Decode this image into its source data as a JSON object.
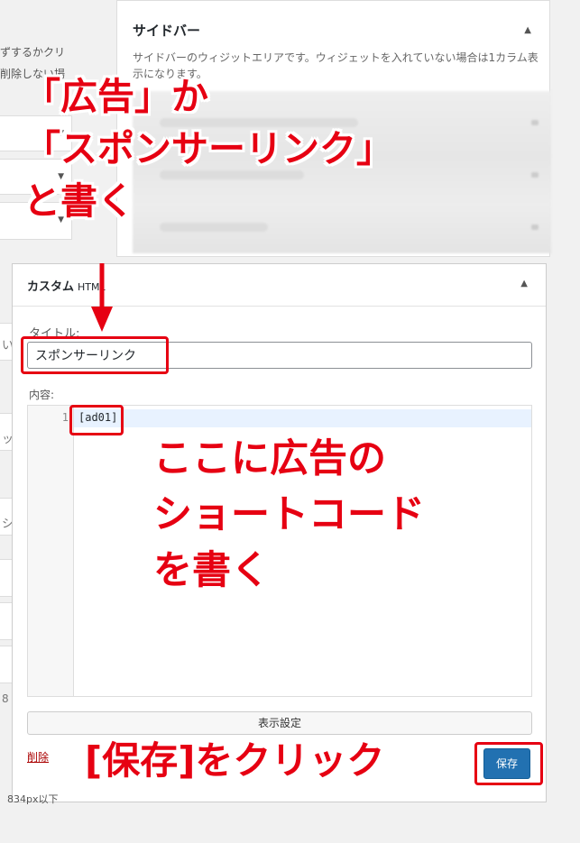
{
  "left_column": {
    "text_line1": "ずするかクリ",
    "text_line2": "削除しない場",
    "fragment_1": "い",
    "fragment_2": "ッ",
    "fragment_3": "シ",
    "fragment_4": "8"
  },
  "sidebar_panel": {
    "title": "サイドバー",
    "toggle_arrow": "▲",
    "description": "サイドバーのウィジットエリアです。ウィジェットを入れていない場合は1カラム表示になります。"
  },
  "widget": {
    "title": "カスタム",
    "subtitle": "HTML",
    "toggle_arrow": "▲",
    "title_label": "タイトル:",
    "title_value": "スポンサーリンク",
    "content_label": "内容:",
    "line_number": "1",
    "code_line": "[ad01]",
    "display_settings_button": "表示設定",
    "delete_link": "削除",
    "save_button": "保存"
  },
  "bottom_text": "834px以下",
  "annotations": {
    "title_hint_line1": "「広告」か",
    "title_hint_line2": "「スポンサーリンク」",
    "title_hint_line3": "と書く",
    "content_hint_line1": "ここに広告の",
    "content_hint_line2": "ショートコード",
    "content_hint_line3": "を書く",
    "save_hint": "[保存]をクリック"
  },
  "colors": {
    "annotation_red": "#e60012",
    "save_button_blue": "#2271b1",
    "delete_link_red": "#a00"
  }
}
